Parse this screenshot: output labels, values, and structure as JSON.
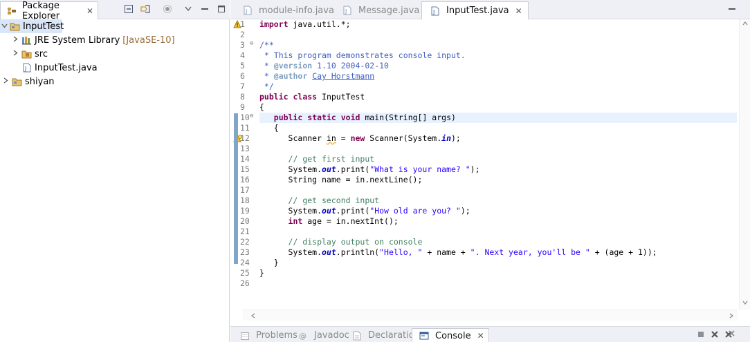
{
  "package_explorer": {
    "tab_label": "Package Explorer",
    "close_glyph": "✕",
    "tree": [
      {
        "label": "InputTest",
        "decor": "",
        "icon": "project-open-icon"
      },
      {
        "label": "JRE System Library",
        "decor": "[JavaSE-10]",
        "icon": "library-icon"
      },
      {
        "label": "src",
        "decor": "",
        "icon": "package-folder-icon"
      },
      {
        "label": "InputTest.java",
        "decor": "",
        "icon": "java-file-icon"
      },
      {
        "label": "shiyan",
        "decor": "",
        "icon": "project-icon"
      }
    ]
  },
  "editor_tabs": [
    {
      "label": "module-info.java",
      "icon": "java-file-icon"
    },
    {
      "label": "Message.java",
      "icon": "java-file-icon"
    },
    {
      "label": "InputTest.java",
      "icon": "java-file-icon",
      "close": "✕"
    }
  ],
  "code": {
    "line_numbers": [
      "1",
      "2",
      "3",
      "4",
      "5",
      "6",
      "7",
      "8",
      "9",
      "10",
      "11",
      "12",
      "13",
      "14",
      "15",
      "16",
      "17",
      "18",
      "19",
      "20",
      "21",
      "22",
      "23",
      "24",
      "25",
      "26"
    ],
    "fold_glyph": "⊖",
    "t": {
      "import": "import",
      "import_rest": " java.util.*;",
      "jd_open": "/**",
      "jd_l4": " * This program demonstrates console input.",
      "jd_star": " * ",
      "at_version": "@version",
      "version_rest": " 1.10 2004-02-10",
      "at_author": "@author",
      "author_sp": " ",
      "author_name": "Cay Horstmann",
      "jd_close": " */",
      "public": "public",
      "class": "class",
      "class_name": " InputTest",
      "brace_open": "{",
      "brace_close": "}",
      "indent3": "   ",
      "indent4": "    ",
      "indent6": "      ",
      "static": "static",
      "void": "void",
      "main_sig": " main(String[] args)",
      "sp": " ",
      "scanner_decl": "Scanner ",
      "in_var": "in",
      "assign_new": " = ",
      "new": "new",
      "scanner_ctor": " Scanner(System.",
      "in_fld": "in",
      "close_paren_semi": ");",
      "cmt_first": "// get first input",
      "system": "System.",
      "out": "out",
      "print_open": ".print(",
      "println_open": ".println(",
      "str_name_q": "\"What is your name? \"",
      "string_decl": "String name = in.nextLine();",
      "cmt_second": "// get second input",
      "str_age_q": "\"How old are you? \"",
      "int": "int",
      "int_rest": " age = in.nextInt();",
      "cmt_display": "// display output on console",
      "str_hello": "\"Hello, \"",
      "plus_name_plus": " + name + ",
      "str_next": "\". Next year, you'll be \"",
      "age_tail": " + (age + 1));",
      "brace_close_i": "   }"
    }
  },
  "bottom_tabs": [
    {
      "label": "Problems",
      "icon": "problems-icon"
    },
    {
      "label": "Javadoc",
      "icon": "javadoc-icon"
    },
    {
      "label": "Declaration",
      "icon": "declaration-icon"
    },
    {
      "label": "Console",
      "icon": "console-icon",
      "close": "✕"
    }
  ],
  "colors": {
    "keyword": "#7f0055",
    "comment": "#3f7f5f",
    "javadoc": "#3f5fbf",
    "string": "#2a00ff",
    "field": "#0000c0",
    "current_line": "#e8f2fe",
    "selection": "#d9e6f7"
  }
}
